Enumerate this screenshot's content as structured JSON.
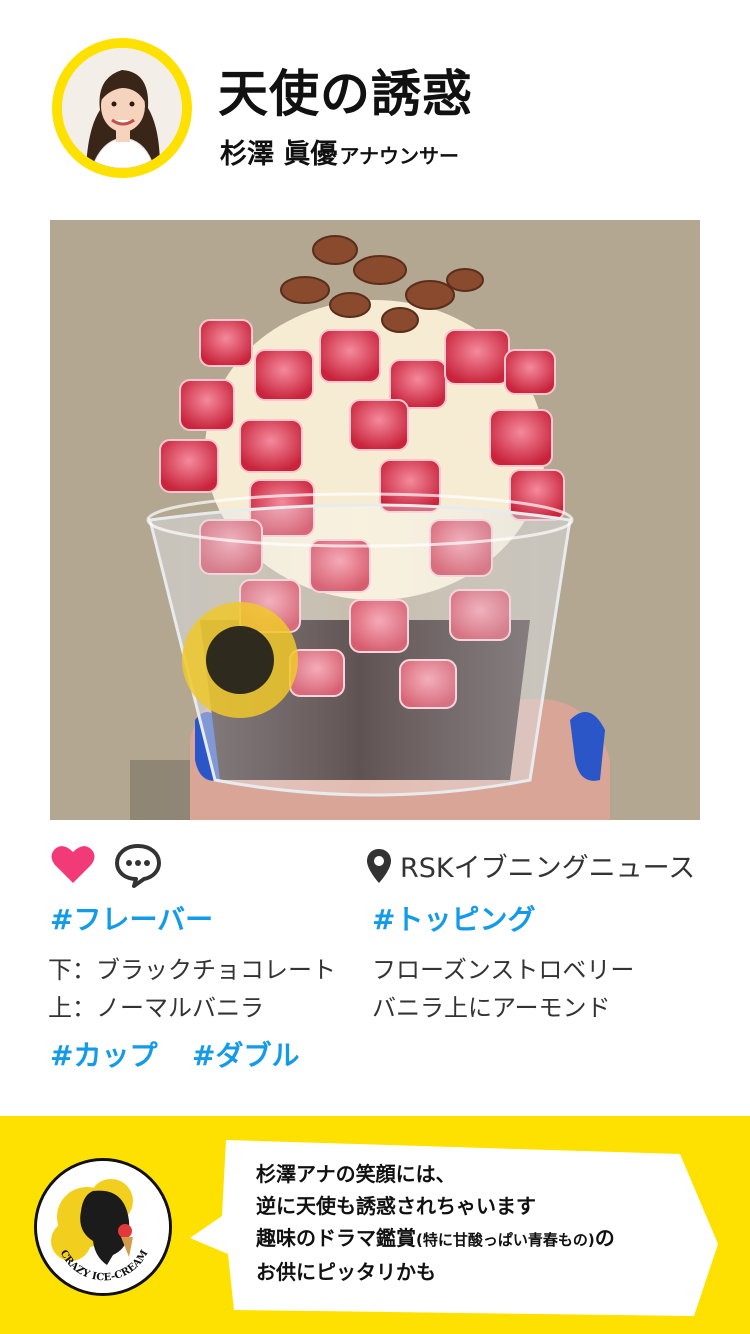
{
  "header": {
    "title": "天使の誘惑",
    "announcer_name": "杉澤 眞優",
    "announcer_role": "アナウンサー"
  },
  "photo": {
    "logo_text": "CRAZY ICE-CREAM"
  },
  "actions": {
    "like_icon": "heart-icon",
    "comment_icon": "comment-bubble-icon",
    "location_icon": "map-pin-icon",
    "location": "RSKイブニングニュース"
  },
  "details": {
    "flavor_tag": "#フレーバー",
    "flavor_lines": [
      "下：ブラックチョコレート",
      "上：ノーマルバニラ"
    ],
    "topping_tag": "#トッピング",
    "topping_lines": [
      "フローズンストロベリー",
      "バニラ上にアーモンド"
    ],
    "cup_tag": "#カップ",
    "size_tag": "#ダブル"
  },
  "footer": {
    "logo_text": "CRAZY ICE-CREAM",
    "comment_line1": "杉澤アナの笑顔には、",
    "comment_line2": "逆に天使も誘惑されちゃいます",
    "comment_line3_main": "趣味のドラマ鑑賞",
    "comment_line3_small": "(特に甘酸っぱい青春もの)",
    "comment_line3_end": "の",
    "comment_line4": "お供にピッタリかも"
  },
  "colors": {
    "accent_yellow": "#ffe100",
    "hashtag_blue": "#139bea",
    "heart_pink": "#f23a78"
  }
}
